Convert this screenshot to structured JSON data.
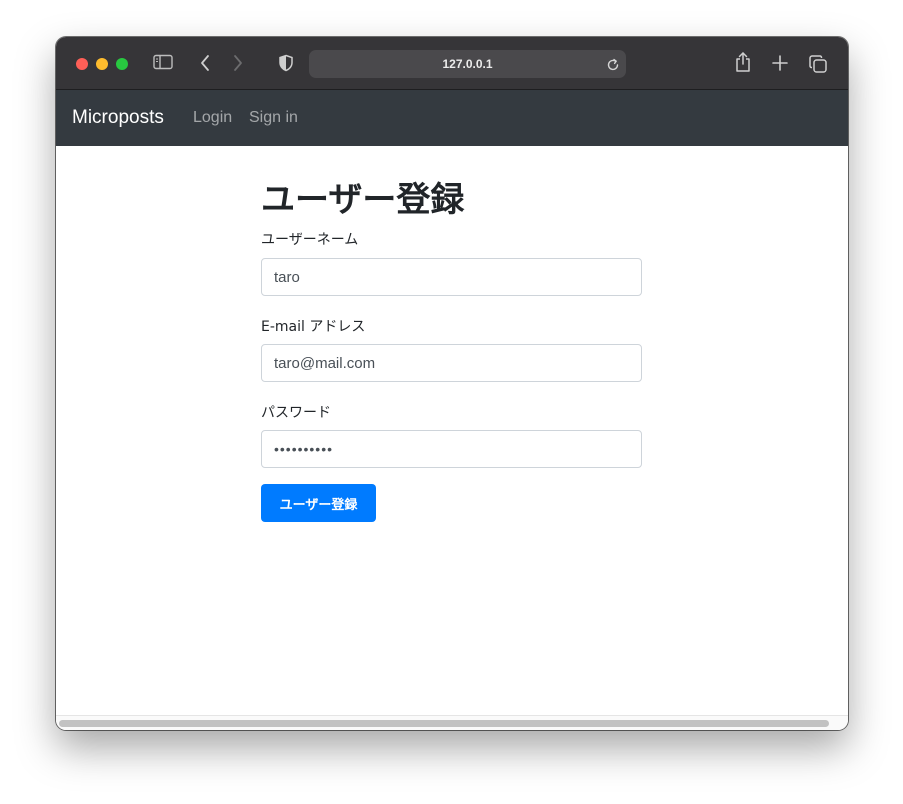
{
  "browser": {
    "url": "127.0.0.1"
  },
  "navbar": {
    "brand": "Microposts",
    "links": [
      {
        "label": "Login"
      },
      {
        "label": "Sign in"
      }
    ]
  },
  "form": {
    "title": "ユーザー登録",
    "username_label": "ユーザーネーム",
    "username_value": "taro",
    "email_label": "E-mail アドレス",
    "email_value": "taro@mail.com",
    "password_label": "パスワード",
    "password_value": "taro123456",
    "submit_label": "ユーザー登録"
  },
  "colors": {
    "navbar_bg": "#343a40",
    "primary": "#007bff",
    "toolbar_bg": "#363538"
  }
}
